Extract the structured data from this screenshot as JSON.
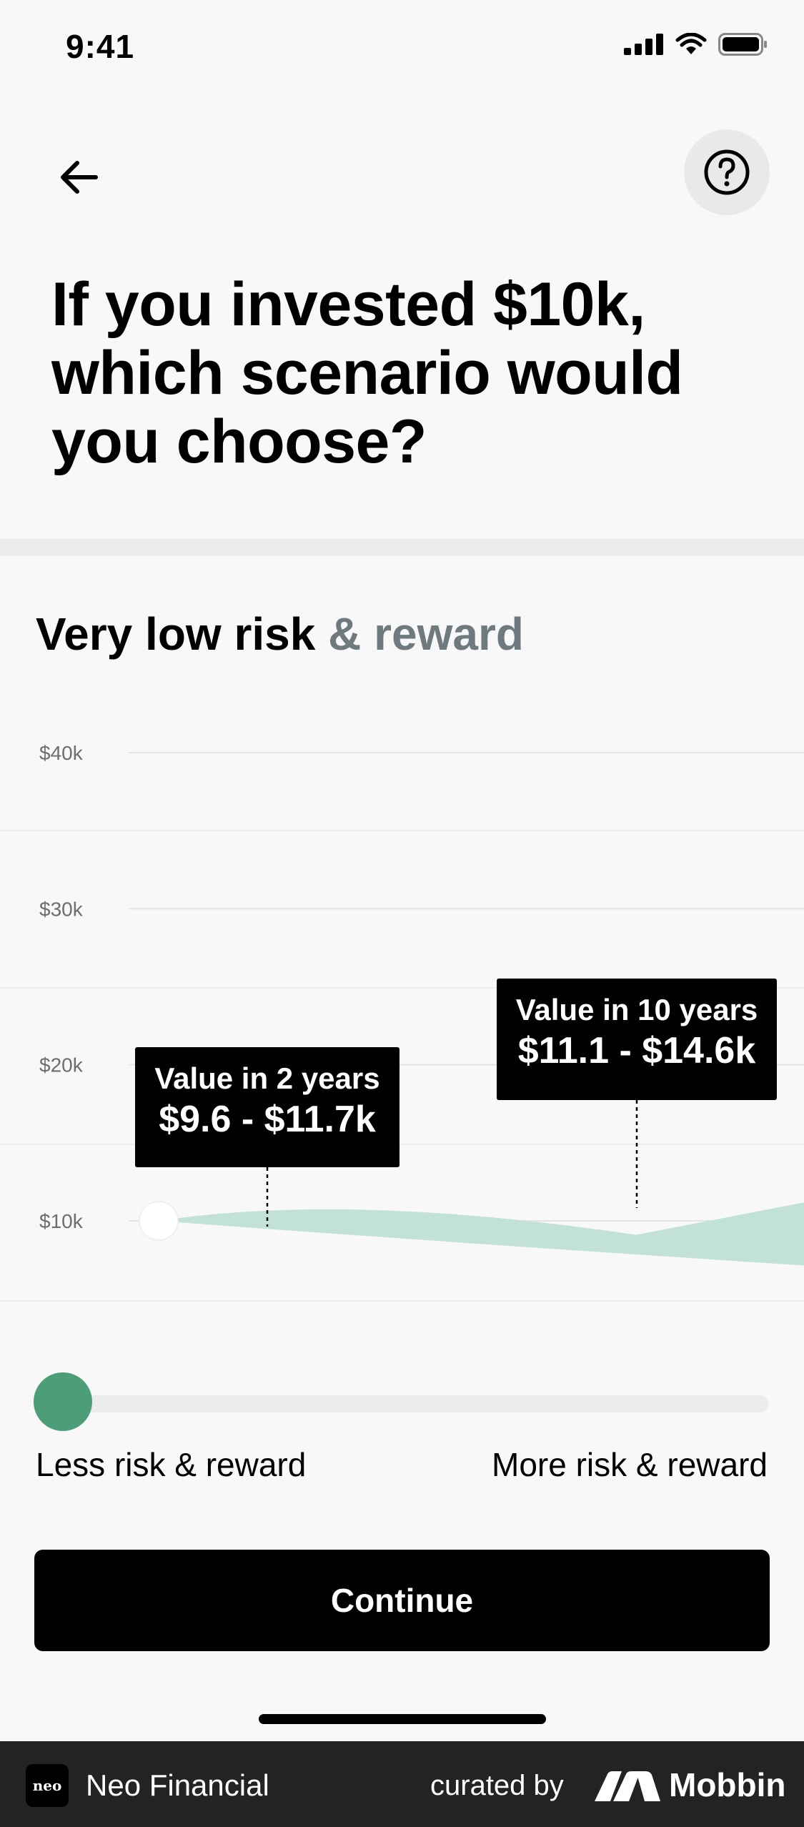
{
  "status_bar": {
    "time": "9:41"
  },
  "headline": "If you invested $10k, which scenario would you choose?",
  "risk_level": {
    "primary": "Very low risk",
    "secondary": "& reward"
  },
  "chart_data": {
    "type": "area",
    "y_tick_labels": [
      "$40k",
      "$30k",
      "$20k",
      "$10k"
    ],
    "ylim": [
      10000,
      40000
    ],
    "start_value": 10000,
    "grid": true,
    "annotations": [
      {
        "label": "Value in 2 years",
        "value": "$9.6 - $11.7k",
        "low": 9600,
        "high": 11700
      },
      {
        "label": "Value in 10 years",
        "value": "$11.1 - $14.6k",
        "low": 11100,
        "high": 14600
      }
    ],
    "colors": {
      "band": "#c2e2d5",
      "grid": "#e4e4e4"
    }
  },
  "slider": {
    "position": 0,
    "min_label": "Less risk & reward",
    "max_label": "More risk & reward",
    "accent": "#4c9e78"
  },
  "actions": {
    "continue_label": "Continue"
  },
  "icons": {
    "back": "arrow-left-icon",
    "help": "question-circle-icon"
  },
  "footer": {
    "logo_text": "neo",
    "app_name": "Neo Financial",
    "curated_by": "curated by",
    "brand": "Mobbin"
  }
}
